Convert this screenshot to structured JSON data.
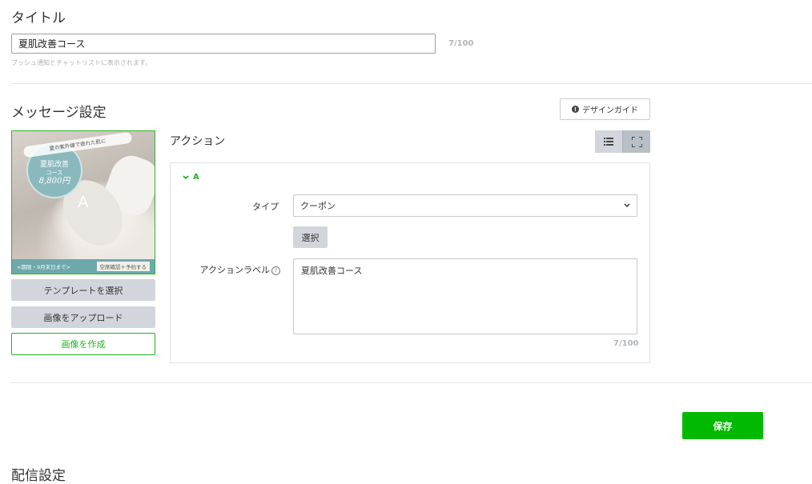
{
  "title_section": {
    "heading": "タイトル",
    "input_value": "夏肌改善コース",
    "counter": "7/100",
    "hint": "プッシュ通知とチャットリストに表示されます。"
  },
  "message_settings": {
    "heading": "メッセージ設定",
    "design_guide_label": "デザインガイド",
    "preview": {
      "badge_top_text": "夏の紫外線で疲れた肌に",
      "badge_line1": "夏肌改善",
      "badge_line2": "コース",
      "badge_price": "8,800円",
      "bottom_left_text": "<期限・9月末日まで>",
      "bottom_right_text": "空席確認＋予約する",
      "area_letter": "A"
    },
    "buttons": {
      "select_template": "テンプレートを選択",
      "upload_image": "画像をアップロード",
      "create_image": "画像を作成"
    }
  },
  "action": {
    "heading": "アクション",
    "area_label": "A",
    "type_label": "タイプ",
    "type_value": "クーポン",
    "select_button": "選択",
    "action_label_label": "アクションラベル",
    "action_label_value": "夏肌改善コース",
    "counter": "7/100"
  },
  "footer": {
    "save_label": "保存",
    "partial_text": "配信設定"
  },
  "colors": {
    "accent_green": "#00b900",
    "button_gray": "#d2d6dc"
  }
}
